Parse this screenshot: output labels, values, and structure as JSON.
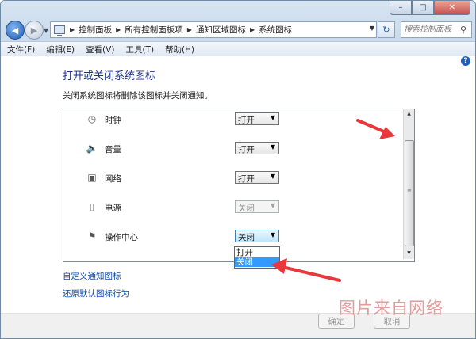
{
  "window": {
    "controls": {
      "minimize": "–",
      "maximize": "□",
      "close": "✕"
    }
  },
  "toolbar": {
    "back_icon": "back-arrow-icon",
    "forward_icon": "forward-arrow-icon",
    "breadcrumbs": [
      "控制面板",
      "所有控制面板项",
      "通知区域图标",
      "系统图标"
    ],
    "search_placeholder": "搜索控制面板"
  },
  "menu": [
    "文件(F)",
    "编辑(E)",
    "查看(V)",
    "工具(T)",
    "帮助(H)"
  ],
  "main": {
    "title": "打开或关闭系统图标",
    "description": "关闭系统图标将删除该图标并关闭通知。",
    "icons": [
      {
        "icon": "clock-icon",
        "label": "时钟",
        "value": "打开",
        "enabled": true
      },
      {
        "icon": "volume-icon",
        "label": "音量",
        "value": "打开",
        "enabled": true
      },
      {
        "icon": "network-icon",
        "label": "网络",
        "value": "打开",
        "enabled": true
      },
      {
        "icon": "power-icon",
        "label": "电源",
        "value": "关闭",
        "enabled": false
      },
      {
        "icon": "action-center-flag-icon",
        "label": "操作中心",
        "value": "关闭",
        "enabled": true
      }
    ],
    "dropdown_options": [
      "打开",
      "关闭"
    ],
    "dropdown_selected": "关闭",
    "links": [
      "自定义通知图标",
      "还原默认图标行为"
    ]
  },
  "buttons": {
    "ok": "确定",
    "cancel": "取消"
  },
  "watermark": "图片来自网络",
  "colors": {
    "title_blue": "#1e3287",
    "link_blue": "#0d4aa8",
    "annotation_red": "#e8383b",
    "selection_blue": "#3399ff"
  }
}
